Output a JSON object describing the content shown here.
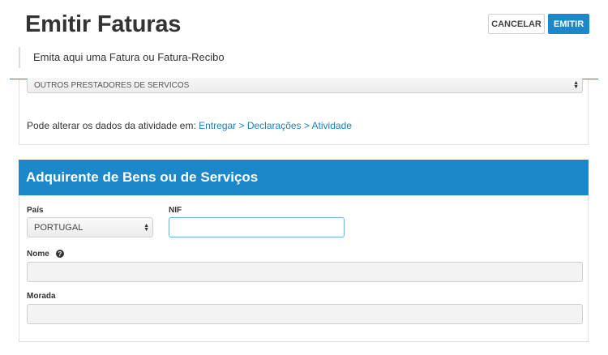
{
  "header": {
    "title": "Emitir Faturas",
    "subtitle": "Emita aqui uma Fatura ou Fatura-Recibo",
    "cancel_label": "CANCELAR",
    "emit_label": "EMITIR"
  },
  "activity": {
    "selected": "OUTROS PRESTADORES DE SERVICOS",
    "change_text": "Pode alterar os dados da atividade em: ",
    "link_text": "Entregar > Declarações > Atividade"
  },
  "buyer": {
    "section_title": "Adquirente de Bens ou de Serviços",
    "country_label": "País",
    "country_value": "PORTUGAL",
    "nif_label": "NIF",
    "nif_value": "",
    "name_label": "Nome",
    "name_value": "",
    "address_label": "Morada",
    "address_value": ""
  },
  "colors": {
    "primary": "#1c87c9",
    "link": "#1c7fc0"
  },
  "icons": {
    "help": "question-circle-icon",
    "select": "updown-arrows-icon"
  }
}
